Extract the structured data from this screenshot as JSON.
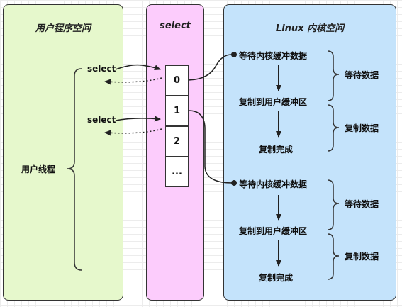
{
  "panels": {
    "user_space": {
      "title": "用户程序空间",
      "color": "#e6f8cc"
    },
    "select": {
      "title": "select",
      "color": "#fcccfc"
    },
    "kernel": {
      "title": "Linux 内核空间",
      "color": "#c4e3fb"
    }
  },
  "user_threads_label": "用户线程",
  "select_calls": [
    "select",
    "select"
  ],
  "fd_slots": [
    "0",
    "1",
    "2",
    "..."
  ],
  "kernel_groups": [
    {
      "wait_kernel_buffer": "等待内核缓冲数据",
      "copy_to_user": "复制到用户缓冲区",
      "copy_done": "复制完成",
      "phase_wait": "等待数据",
      "phase_copy": "复制数据"
    },
    {
      "wait_kernel_buffer": "等待内核缓冲数据",
      "copy_to_user": "复制到用户缓冲区",
      "copy_done": "复制完成",
      "phase_wait": "等待数据",
      "phase_copy": "复制数据"
    }
  ]
}
